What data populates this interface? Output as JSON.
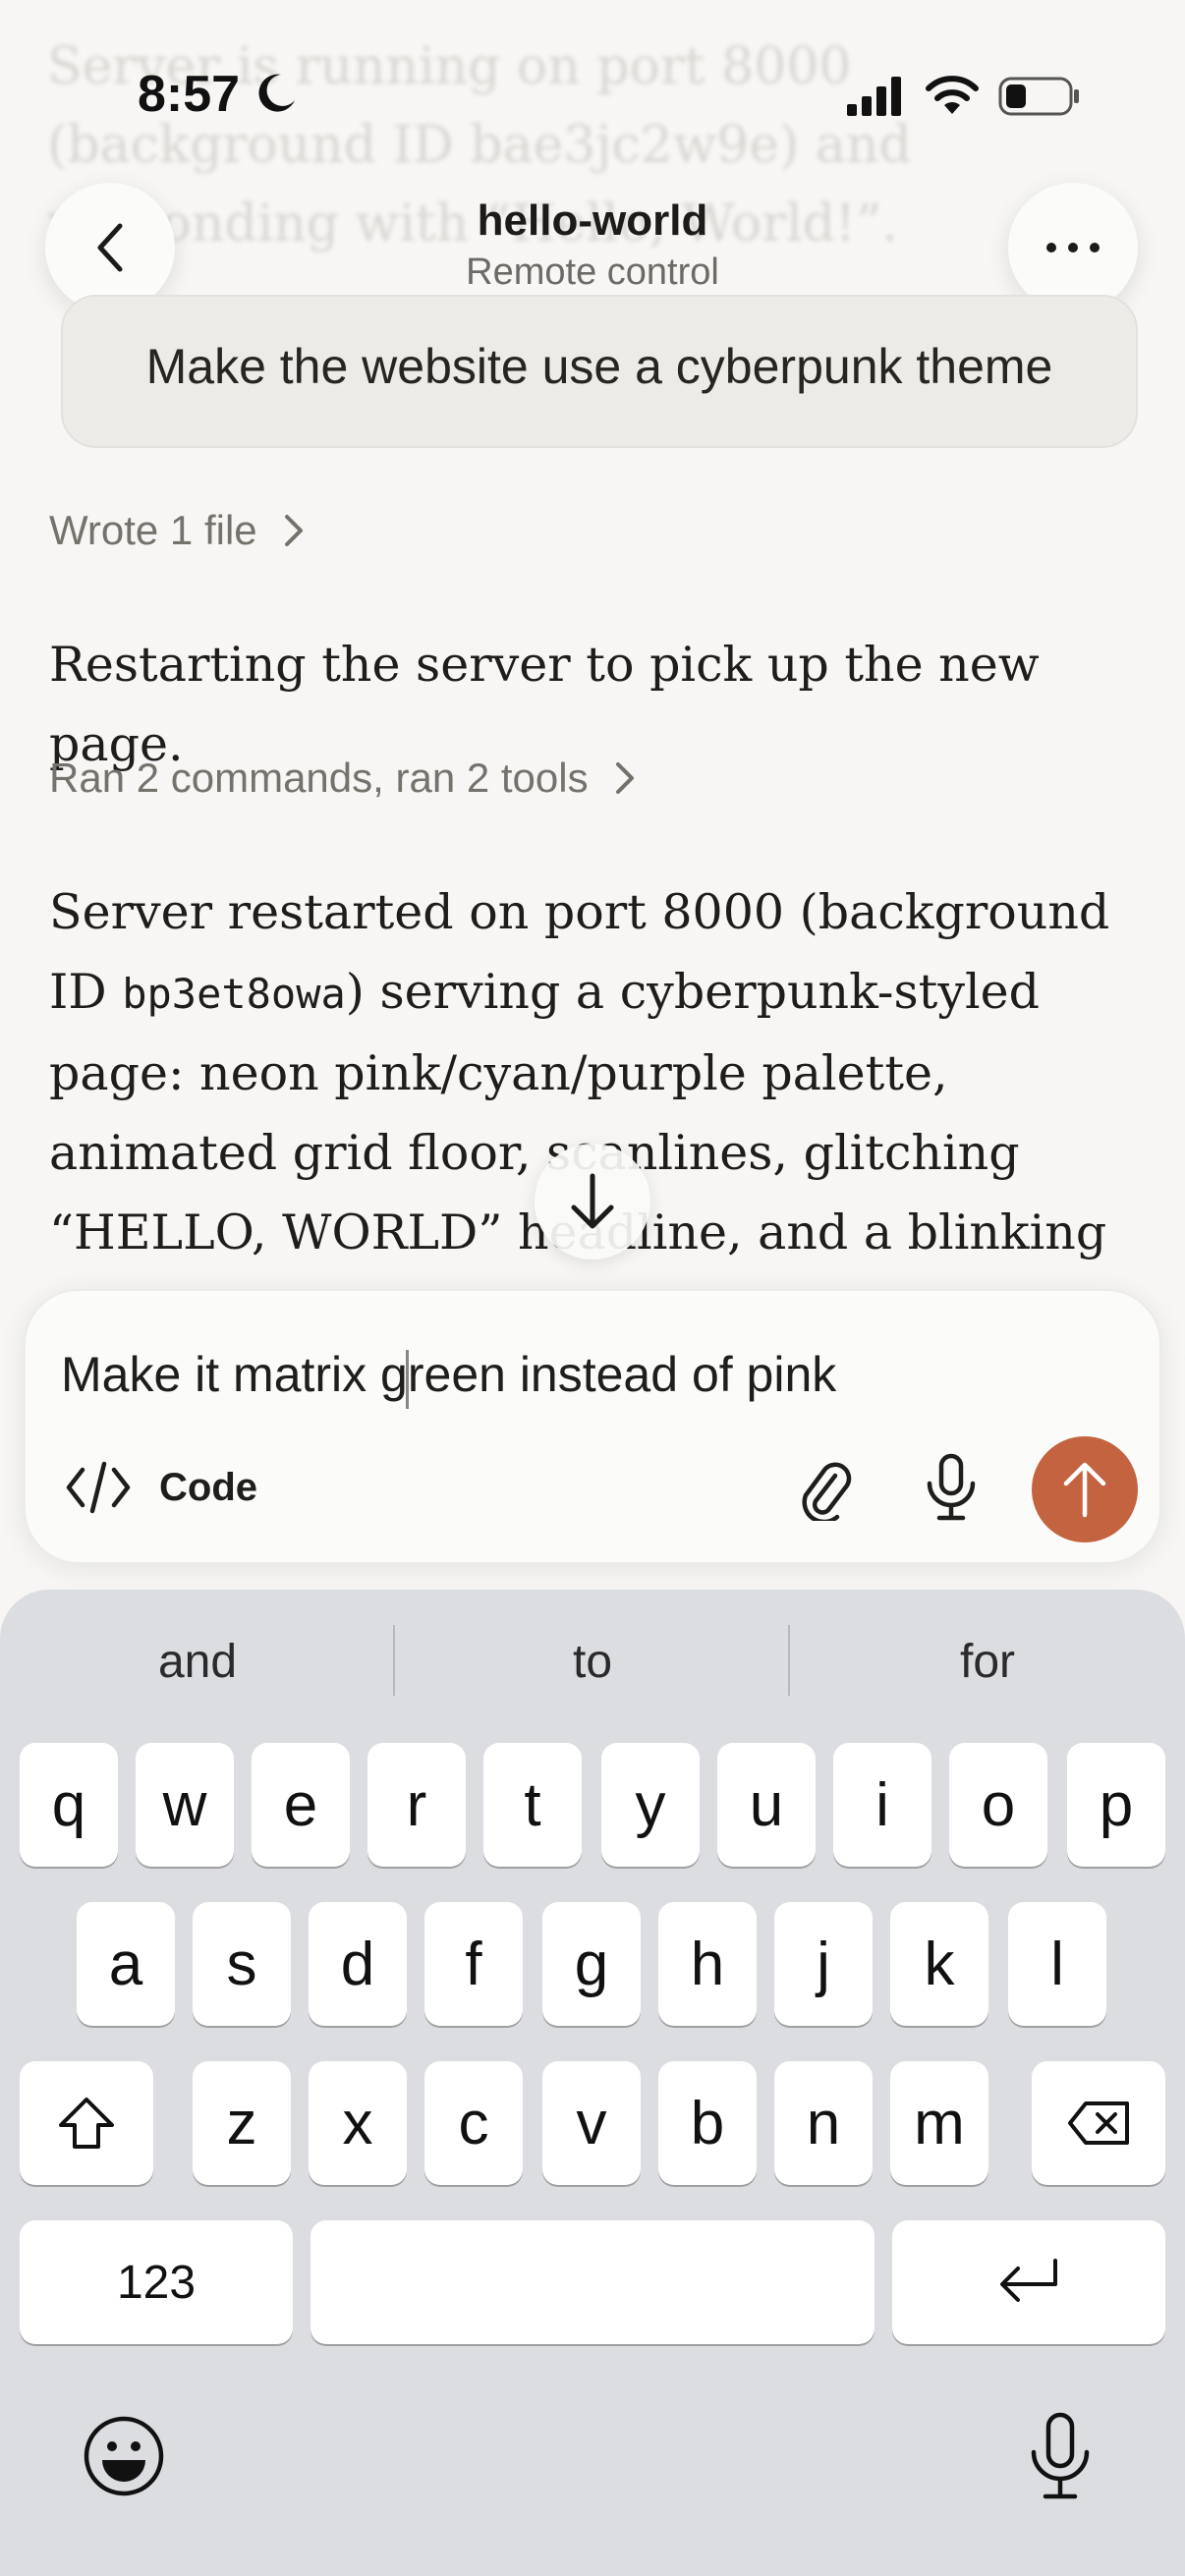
{
  "background_text": "Server is running on port 8000 (background ID bae3jc2w9e) and responding with “Hello, World!”.",
  "status_bar": {
    "time": "8:57"
  },
  "header": {
    "title": "hello-world",
    "subtitle": "Remote control"
  },
  "messages": {
    "user_prompt": "Make the website use a cyberpunk theme",
    "tool_summary_1": "Wrote 1 file",
    "assistant_1": "Restarting the server to pick up the new page.",
    "tool_summary_2": "Ran 2 commands, ran 2 tools",
    "assistant_2_pre": "Server restarted on port 8000 (background ID ",
    "assistant_2_code": "bp3et8owa",
    "assistant_2_post": ") serving a cyberpunk-styled page: neon pink/cyan/purple palette, animated grid floor, scanlines, glitching “HELLO, WORLD” headline, and a blinking terminal cursor."
  },
  "composer": {
    "input_value": "Make it matrix green instead of pink",
    "mode_label": "Code",
    "send_color": "#c4633f"
  },
  "keyboard": {
    "suggestions": [
      "and",
      "to",
      "for"
    ],
    "row1": [
      "q",
      "w",
      "e",
      "r",
      "t",
      "y",
      "u",
      "i",
      "o",
      "p"
    ],
    "row2": [
      "a",
      "s",
      "d",
      "f",
      "g",
      "h",
      "j",
      "k",
      "l"
    ],
    "row3": [
      "z",
      "x",
      "c",
      "v",
      "b",
      "n",
      "m"
    ],
    "numbers_label": "123"
  },
  "icons": [
    "moon-icon",
    "signal-icon",
    "wifi-icon",
    "battery-icon",
    "back-icon",
    "more-icon",
    "chevron-right-icon",
    "arrow-down-icon",
    "code-icon",
    "paperclip-icon",
    "microphone-icon",
    "arrow-up-icon",
    "shift-icon",
    "backspace-icon",
    "return-icon",
    "emoji-icon"
  ]
}
